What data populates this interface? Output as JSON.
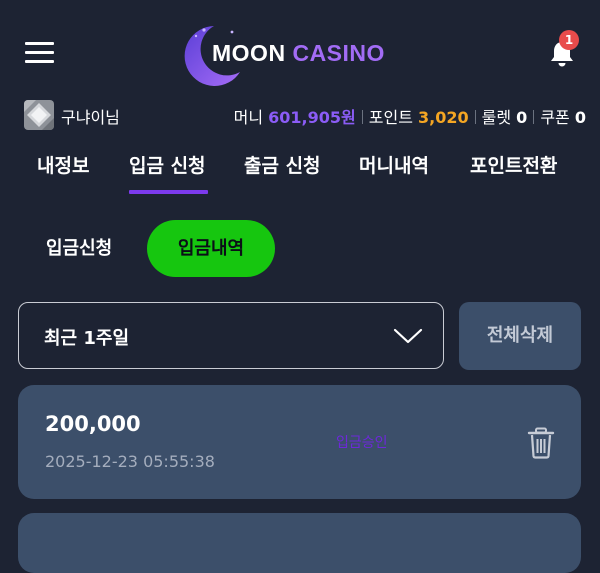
{
  "header": {
    "logo_word1": "MOON",
    "logo_word2": "CASINO",
    "notification_count": "1"
  },
  "user": {
    "name": "구냐이님",
    "money_label": "머니",
    "money_value": "601,905원",
    "point_label": "포인트",
    "point_value": "3,020",
    "roulette_label": "룰렛",
    "roulette_value": "0",
    "coupon_label": "쿠폰",
    "coupon_value": "0"
  },
  "tabs": [
    {
      "label": "내정보"
    },
    {
      "label": "입금 신청",
      "active": true
    },
    {
      "label": "출금 신청"
    },
    {
      "label": "머니내역"
    },
    {
      "label": "포인트전환"
    }
  ],
  "sub_tabs": {
    "request": "입금신청",
    "history": "입금내역"
  },
  "filter": {
    "period": "최근 1주일",
    "delete_all": "전체삭제"
  },
  "deposits": [
    {
      "amount": "200,000",
      "datetime": "2025-12-23 05:55:38",
      "status": "입금승인"
    }
  ],
  "colors": {
    "background": "#1d2333",
    "card": "#3c4f6a",
    "accent_green": "#16c60f",
    "accent_purple": "#7c3aed",
    "points_orange": "#f5a623",
    "badge_red": "#e84b4b"
  },
  "icons": [
    "hamburger-icon",
    "moon-logo-icon",
    "bell-icon",
    "avatar",
    "chevron-down-icon",
    "trash-icon"
  ]
}
